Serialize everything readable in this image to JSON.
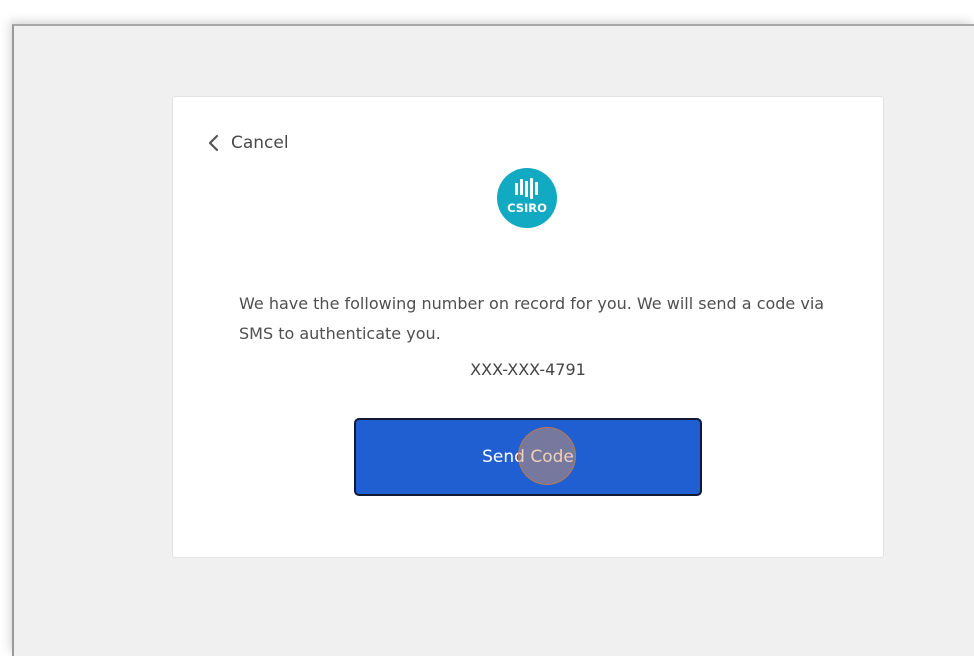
{
  "nav": {
    "cancel_label": "Cancel",
    "cancel_icon": "chevron-left-icon"
  },
  "logo": {
    "text": "CSIRO",
    "color": "#12a9c2"
  },
  "body": {
    "message": "We have the following number on record for you. We will send a code via SMS to authenticate you.",
    "phone_number": "XXX-XXX-4791"
  },
  "actions": {
    "send_code_label": "Send Code",
    "button_color": "#1f5fd1"
  }
}
